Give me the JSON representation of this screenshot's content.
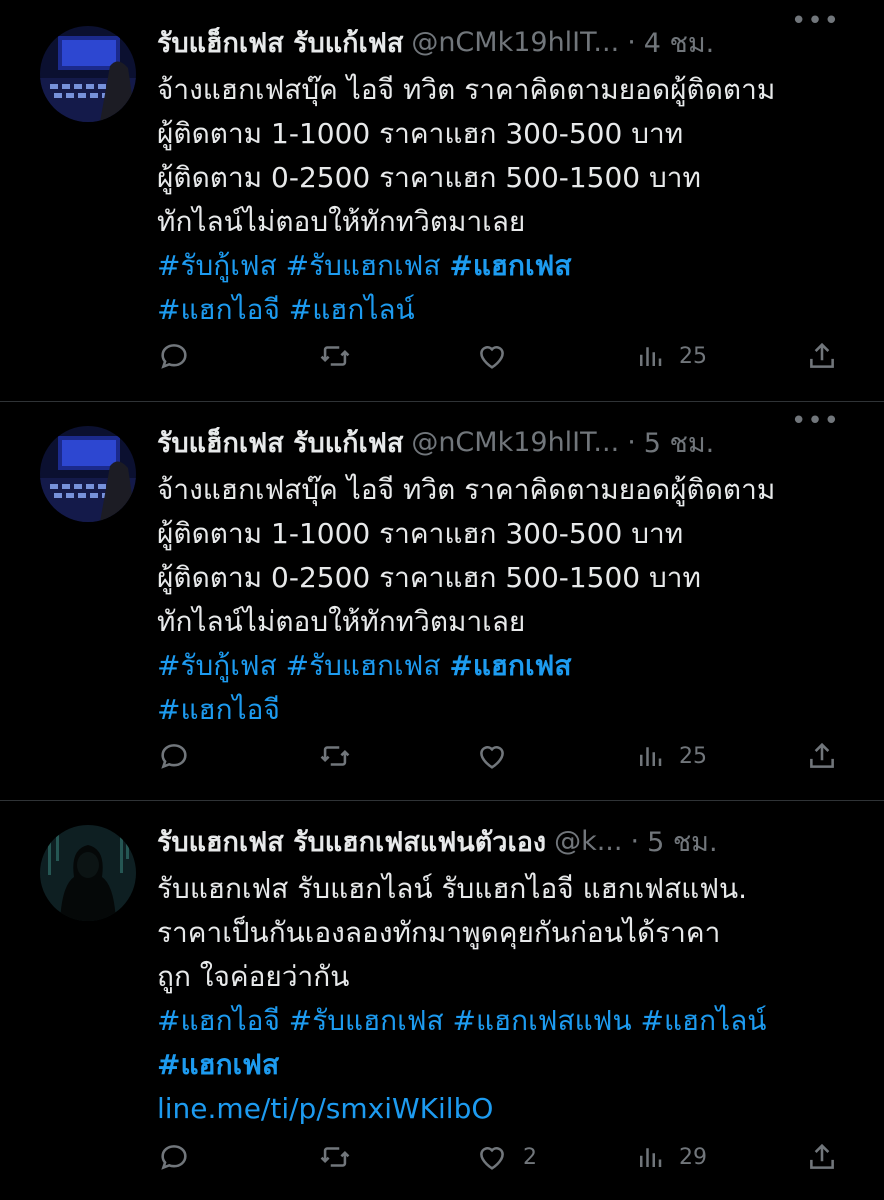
{
  "tweets": [
    {
      "name": "รับแฮ็กเฟส รับแก้เฟส",
      "handle": "@nCMk19hlIT...",
      "dot": "·",
      "time": "4 ชม.",
      "more_icon": "more-dots-icon",
      "lines": [
        "จ้างแฮกเฟสบุ๊ค ไอจี ทวิต ราคาคิดตามยอดผู้ติดตาม",
        "ผู้ติดตาม 1-1000 ราคาแฮก 300-500 บาท",
        "ผู้ติดตาม 0-2500 ราคาแฮก 500-1500 บาท",
        "ทักไลน์ไม่ตอบให้ทักทวิตมาเลย"
      ],
      "tag_lines": [
        [
          "#รับกู้เฟส",
          "#รับแฮกเฟส",
          "#แฮกเฟส"
        ],
        [
          "#แฮกไอจี",
          "#แฮกไลน์"
        ]
      ],
      "views": "25"
    },
    {
      "name": "รับแฮ็กเฟส รับแก้เฟส",
      "handle": "@nCMk19hlIT...",
      "dot": "·",
      "time": "5 ชม.",
      "more_icon": "more-dots-icon",
      "lines": [
        "จ้างแฮกเฟสบุ๊ค ไอจี ทวิต ราคาคิดตามยอดผู้ติดตาม",
        "ผู้ติดตาม 1-1000 ราคาแฮก 300-500 บาท",
        "ผู้ติดตาม 0-2500 ราคาแฮก 500-1500 บาท",
        "ทักไลน์ไม่ตอบให้ทักทวิตมาเลย"
      ],
      "tag_lines": [
        [
          "#รับกู้เฟส",
          "#รับแฮกเฟส",
          "#แฮกเฟส"
        ],
        [
          "#แฮกไอจี"
        ]
      ],
      "views": "25"
    },
    {
      "name": "รับแฮกเฟส รับแฮกเฟสแฟนตัวเอง",
      "handle": "@k...",
      "dot": "·",
      "time": "5 ชม.",
      "more_icon": "more-dots-icon",
      "lines": [
        "รับแฮกเฟส รับแฮกไลน์ รับแฮกไอจี แฮกเฟสแฟน.",
        "ราคาเป็นกันเองลองทักมาพูดคุยกันก่อนได้ราคา",
        "ถูก ใจค่อยว่ากัน"
      ],
      "tag_lines": [
        [
          "#แฮกไอจี",
          "#รับแฮกเฟส",
          "#แฮกเฟสแฟน",
          "#แฮกไลน์"
        ],
        [
          "#แฮกเฟส"
        ]
      ],
      "link": "line.me/ti/p/smxiWKilbO",
      "likes": "2",
      "views": "29"
    }
  ],
  "icons": {
    "reply": "reply-icon",
    "retweet": "retweet-icon",
    "like": "like-icon",
    "views": "views-icon",
    "share": "share-icon"
  },
  "colors": {
    "background": "#000000",
    "text": "#e7e9ea",
    "muted": "#71767b",
    "accent": "#1d9bf0",
    "divider": "#2f3336"
  }
}
